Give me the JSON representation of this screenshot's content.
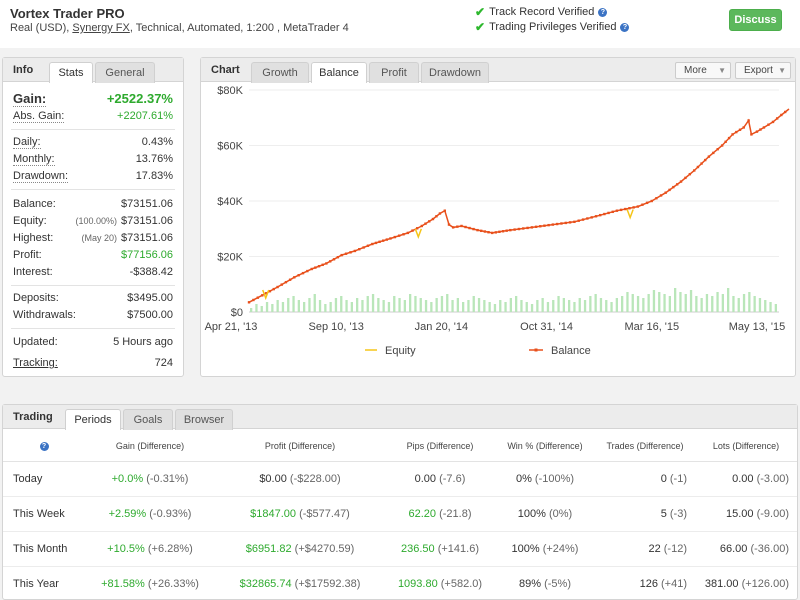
{
  "header": {
    "title": "Vortex Trader PRO",
    "info_prefix": "Real (USD),",
    "broker": "Synergy FX",
    "info_suffix": ", Technical, Automated, 1:200 , MetaTrader 4",
    "verified_track": "Track Record Verified",
    "verified_priv": "Trading Privileges Verified",
    "discuss_label": "Discuss"
  },
  "info": {
    "title": "Info",
    "tabs": [
      "Stats",
      "General"
    ],
    "gain_label": "Gain:",
    "gain_value": "+2522.37%",
    "abs_gain_label": "Abs. Gain:",
    "abs_gain_value": "+2207.61%",
    "daily_label": "Daily:",
    "daily_value": "0.43%",
    "monthly_label": "Monthly:",
    "monthly_value": "13.76%",
    "drawdown_label": "Drawdown:",
    "drawdown_value": "17.83%",
    "balance_label": "Balance:",
    "balance_value": "$73151.06",
    "equity_label": "Equity:",
    "equity_note": "(100.00%)",
    "equity_value": "$73151.06",
    "highest_label": "Highest:",
    "highest_note": "(May 20)",
    "highest_value": "$73151.06",
    "profit_label": "Profit:",
    "profit_value": "$77156.06",
    "interest_label": "Interest:",
    "interest_value": "-$388.42",
    "deposits_label": "Deposits:",
    "deposits_value": "$3495.00",
    "withdrawals_label": "Withdrawals:",
    "withdrawals_value": "$7500.00",
    "updated_label": "Updated:",
    "updated_value": "5 Hours ago",
    "tracking_label": "Tracking:",
    "tracking_value": "724"
  },
  "chart_panel": {
    "title": "Chart",
    "tabs": [
      "Growth",
      "Balance",
      "Profit",
      "Drawdown"
    ],
    "active_tab": "Balance",
    "more_label": "More",
    "export_label": "Export"
  },
  "chart_data": {
    "type": "line",
    "x_ticks": [
      "Apr 21, '13",
      "Sep 10, '13",
      "Jan 20, '14",
      "Oct 31, '14",
      "Mar 16, '15",
      "May 13, '15"
    ],
    "y_ticks": [
      "$0",
      "$20K",
      "$40K",
      "$60K",
      "$80K"
    ],
    "ylim": [
      0,
      80000
    ],
    "x_start": "2013-04-21",
    "x_end": "2015-05-13",
    "series": [
      {
        "name": "Balance",
        "color": "#e8501c",
        "points": [
          [
            "2013-04-21",
            3500
          ],
          [
            "2013-05-10",
            6000
          ],
          [
            "2013-06-01",
            9000
          ],
          [
            "2013-06-25",
            12500
          ],
          [
            "2013-07-20",
            15500
          ],
          [
            "2013-08-10",
            17500
          ],
          [
            "2013-09-01",
            20500
          ],
          [
            "2013-09-20",
            22000
          ],
          [
            "2013-10-15",
            24500
          ],
          [
            "2013-11-10",
            26500
          ],
          [
            "2013-12-05",
            28500
          ],
          [
            "2013-12-25",
            31000
          ],
          [
            "2014-01-10",
            33500
          ],
          [
            "2014-01-20",
            35500
          ],
          [
            "2014-01-27",
            36500
          ],
          [
            "2014-02-02",
            31500
          ],
          [
            "2014-02-08",
            30500
          ],
          [
            "2014-02-20",
            31000
          ],
          [
            "2014-03-15",
            29500
          ],
          [
            "2014-04-05",
            28500
          ],
          [
            "2014-05-01",
            29500
          ],
          [
            "2014-06-01",
            30500
          ],
          [
            "2014-07-01",
            31500
          ],
          [
            "2014-08-01",
            32500
          ],
          [
            "2014-09-01",
            34500
          ],
          [
            "2014-10-01",
            36500
          ],
          [
            "2014-10-31",
            38000
          ],
          [
            "2014-11-20",
            40000
          ],
          [
            "2014-12-10",
            43000
          ],
          [
            "2015-01-01",
            47000
          ],
          [
            "2015-01-20",
            51000
          ],
          [
            "2015-02-10",
            56000
          ],
          [
            "2015-03-01",
            60000
          ],
          [
            "2015-03-16",
            64000
          ],
          [
            "2015-04-01",
            66500
          ],
          [
            "2015-04-08",
            69000
          ],
          [
            "2015-04-12",
            64000
          ],
          [
            "2015-04-20",
            65000
          ],
          [
            "2015-04-30",
            66500
          ],
          [
            "2015-05-13",
            68500
          ],
          [
            "2015-05-25",
            71000
          ],
          [
            "2015-06-05",
            73151
          ]
        ]
      },
      {
        "name": "Equity",
        "color": "#f5c518",
        "points": [
          [
            "2013-05-15",
            6500
          ],
          [
            "2013-12-20",
            28500
          ],
          [
            "2014-10-20",
            35500
          ]
        ]
      }
    ],
    "volume_bars": [
      2,
      4,
      3,
      5,
      4,
      6,
      5,
      7,
      8,
      6,
      5,
      7,
      9,
      6,
      4,
      5,
      7,
      8,
      6,
      5,
      7,
      6,
      8,
      9,
      7,
      6,
      5,
      8,
      7,
      6,
      9,
      8,
      7,
      6,
      5,
      7,
      8,
      9,
      6,
      7,
      5,
      6,
      8,
      7,
      6,
      5,
      4,
      6,
      5,
      7,
      8,
      6,
      5,
      4,
      6,
      7,
      5,
      6,
      8,
      7,
      6,
      5,
      7,
      6,
      8,
      9,
      7,
      6,
      5,
      7,
      8,
      10,
      9,
      8,
      7,
      9,
      11,
      10,
      9,
      8,
      12,
      10,
      9,
      11,
      8,
      7,
      9,
      8,
      10,
      9,
      12,
      8,
      7,
      9,
      10,
      8,
      7,
      6,
      5,
      4
    ],
    "legend": [
      "Equity",
      "Balance"
    ]
  },
  "trading": {
    "title": "Trading",
    "tabs": [
      "Periods",
      "Goals",
      "Browser"
    ],
    "columns": [
      "Gain (Difference)",
      "Profit (Difference)",
      "Pips (Difference)",
      "Win % (Difference)",
      "Trades (Difference)",
      "Lots (Difference)"
    ],
    "rows": [
      {
        "period": "Today",
        "gain": "+0.0%",
        "gain_diff": "(-0.31%)",
        "profit": "$0.00",
        "profit_diff": "(-$228.00)",
        "pips": "0.00",
        "pips_diff": "(-7.6)",
        "win": "0%",
        "win_diff": "(-100%)",
        "trades": "0",
        "trades_diff": "(-1)",
        "lots": "0.00",
        "lots_diff": "(-3.00)",
        "gain_pos": true,
        "profit_pos": false,
        "pips_pos": false
      },
      {
        "period": "This Week",
        "gain": "+2.59%",
        "gain_diff": "(-0.93%)",
        "profit": "$1847.00",
        "profit_diff": "(-$577.47)",
        "pips": "62.20",
        "pips_diff": "(-21.8)",
        "win": "100%",
        "win_diff": "(0%)",
        "trades": "5",
        "trades_diff": "(-3)",
        "lots": "15.00",
        "lots_diff": "(-9.00)",
        "gain_pos": true,
        "profit_pos": true,
        "pips_pos": true
      },
      {
        "period": "This Month",
        "gain": "+10.5%",
        "gain_diff": "(+6.28%)",
        "profit": "$6951.82",
        "profit_diff": "(+$4270.59)",
        "pips": "236.50",
        "pips_diff": "(+141.6)",
        "win": "100%",
        "win_diff": "(+24%)",
        "trades": "22",
        "trades_diff": "(-12)",
        "lots": "66.00",
        "lots_diff": "(-36.00)",
        "gain_pos": true,
        "profit_pos": true,
        "pips_pos": true
      },
      {
        "period": "This Year",
        "gain": "+81.58%",
        "gain_diff": "(+26.33%)",
        "profit": "$32865.74",
        "profit_diff": "(+$17592.38)",
        "pips": "1093.80",
        "pips_diff": "(+582.0)",
        "win": "89%",
        "win_diff": "(-5%)",
        "trades": "126",
        "trades_diff": "(+41)",
        "lots": "381.00",
        "lots_diff": "(+126.00)",
        "gain_pos": true,
        "profit_pos": true,
        "pips_pos": true
      }
    ]
  }
}
